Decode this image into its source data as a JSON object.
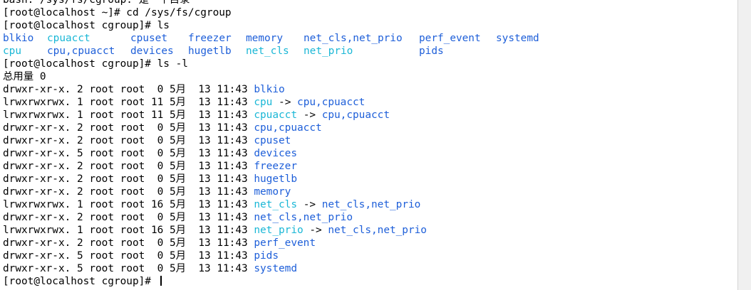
{
  "prev_line": "bash: /sys/fs/cgroup: 是一个目录",
  "cmd1": {
    "prompt": "[root@localhost ~]#",
    "command": "cd /sys/fs/cgroup"
  },
  "cmd2": {
    "prompt": "[root@localhost cgroup]#",
    "command": "ls"
  },
  "ls_row1": [
    {
      "name": "blkio",
      "type": "dir"
    },
    {
      "name": "cpuacct",
      "type": "link"
    },
    {
      "name": "cpuset",
      "type": "dir"
    },
    {
      "name": "freezer",
      "type": "dir"
    },
    {
      "name": "memory",
      "type": "dir"
    },
    {
      "name": "net_cls,net_prio",
      "type": "dir"
    },
    {
      "name": "perf_event",
      "type": "dir"
    },
    {
      "name": "systemd",
      "type": "dir"
    }
  ],
  "ls_row2": [
    {
      "name": "cpu",
      "type": "link"
    },
    {
      "name": "cpu,cpuacct",
      "type": "dir"
    },
    {
      "name": "devices",
      "type": "dir"
    },
    {
      "name": "hugetlb",
      "type": "dir"
    },
    {
      "name": "net_cls",
      "type": "link"
    },
    {
      "name": "net_prio",
      "type": "link"
    },
    {
      "name": "pids",
      "type": "dir"
    }
  ],
  "cmd3": {
    "prompt": "[root@localhost cgroup]#",
    "command": "ls -l"
  },
  "total_line": "总用量 0",
  "ll_entries": [
    {
      "perms": "drwxr-xr-x.",
      "links": "2",
      "user": "root",
      "group": "root",
      "size": " 0",
      "date": "5月  13 11:43",
      "name": "blkio",
      "type": "dir",
      "target": ""
    },
    {
      "perms": "lrwxrwxrwx.",
      "links": "1",
      "user": "root",
      "group": "root",
      "size": "11",
      "date": "5月  13 11:43",
      "name": "cpu",
      "type": "link",
      "target": "cpu,cpuacct"
    },
    {
      "perms": "lrwxrwxrwx.",
      "links": "1",
      "user": "root",
      "group": "root",
      "size": "11",
      "date": "5月  13 11:43",
      "name": "cpuacct",
      "type": "link",
      "target": "cpu,cpuacct"
    },
    {
      "perms": "drwxr-xr-x.",
      "links": "2",
      "user": "root",
      "group": "root",
      "size": " 0",
      "date": "5月  13 11:43",
      "name": "cpu,cpuacct",
      "type": "dir",
      "target": ""
    },
    {
      "perms": "drwxr-xr-x.",
      "links": "2",
      "user": "root",
      "group": "root",
      "size": " 0",
      "date": "5月  13 11:43",
      "name": "cpuset",
      "type": "dir",
      "target": ""
    },
    {
      "perms": "drwxr-xr-x.",
      "links": "5",
      "user": "root",
      "group": "root",
      "size": " 0",
      "date": "5月  13 11:43",
      "name": "devices",
      "type": "dir",
      "target": ""
    },
    {
      "perms": "drwxr-xr-x.",
      "links": "2",
      "user": "root",
      "group": "root",
      "size": " 0",
      "date": "5月  13 11:43",
      "name": "freezer",
      "type": "dir",
      "target": ""
    },
    {
      "perms": "drwxr-xr-x.",
      "links": "2",
      "user": "root",
      "group": "root",
      "size": " 0",
      "date": "5月  13 11:43",
      "name": "hugetlb",
      "type": "dir",
      "target": ""
    },
    {
      "perms": "drwxr-xr-x.",
      "links": "2",
      "user": "root",
      "group": "root",
      "size": " 0",
      "date": "5月  13 11:43",
      "name": "memory",
      "type": "dir",
      "target": ""
    },
    {
      "perms": "lrwxrwxrwx.",
      "links": "1",
      "user": "root",
      "group": "root",
      "size": "16",
      "date": "5月  13 11:43",
      "name": "net_cls",
      "type": "link",
      "target": "net_cls,net_prio"
    },
    {
      "perms": "drwxr-xr-x.",
      "links": "2",
      "user": "root",
      "group": "root",
      "size": " 0",
      "date": "5月  13 11:43",
      "name": "net_cls,net_prio",
      "type": "dir",
      "target": ""
    },
    {
      "perms": "lrwxrwxrwx.",
      "links": "1",
      "user": "root",
      "group": "root",
      "size": "16",
      "date": "5月  13 11:43",
      "name": "net_prio",
      "type": "link",
      "target": "net_cls,net_prio"
    },
    {
      "perms": "drwxr-xr-x.",
      "links": "2",
      "user": "root",
      "group": "root",
      "size": " 0",
      "date": "5月  13 11:43",
      "name": "perf_event",
      "type": "dir",
      "target": ""
    },
    {
      "perms": "drwxr-xr-x.",
      "links": "5",
      "user": "root",
      "group": "root",
      "size": " 0",
      "date": "5月  13 11:43",
      "name": "pids",
      "type": "dir",
      "target": ""
    },
    {
      "perms": "drwxr-xr-x.",
      "links": "5",
      "user": "root",
      "group": "root",
      "size": " 0",
      "date": "5月  13 11:43",
      "name": "systemd",
      "type": "dir",
      "target": ""
    }
  ],
  "cmd4": {
    "prompt": "[root@localhost cgroup]#",
    "command": ""
  },
  "arrow": "->",
  "colors": {
    "dir": "#1e5fd9",
    "link": "#1ab7d6",
    "text": "#000000",
    "background": "#ffffff"
  }
}
